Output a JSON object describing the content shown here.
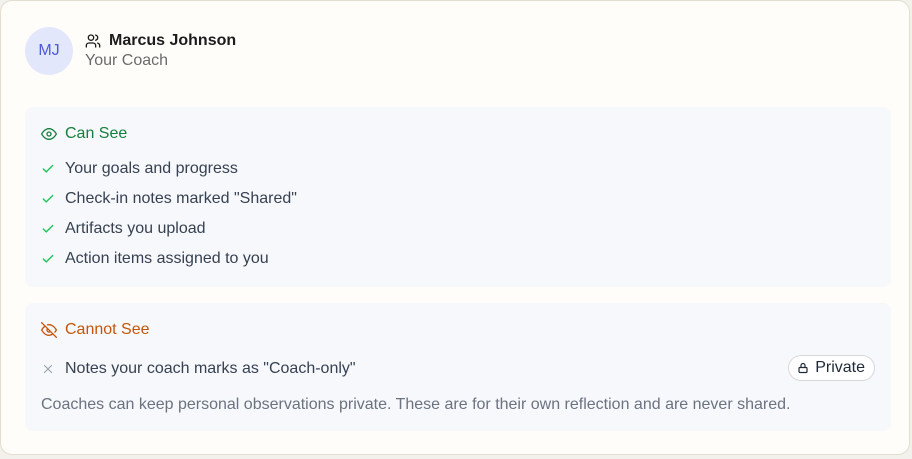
{
  "coach": {
    "initials": "MJ",
    "icon": "users-icon",
    "name": "Marcus Johnson",
    "role": "Your Coach"
  },
  "can_see": {
    "title": "Can See",
    "icon": "eye-icon",
    "color": "#15803d",
    "items": [
      "Your goals and progress",
      "Check-in notes marked \"Shared\"",
      "Artifacts you upload",
      "Action items assigned to you"
    ]
  },
  "cannot_see": {
    "title": "Cannot See",
    "icon": "eye-off-icon",
    "color": "#c2560c",
    "items": [
      "Notes your coach marks as \"Coach-only\""
    ],
    "badge": "Private",
    "note": "Coaches can keep personal observations private. These are for their own reflection and are never shared."
  }
}
